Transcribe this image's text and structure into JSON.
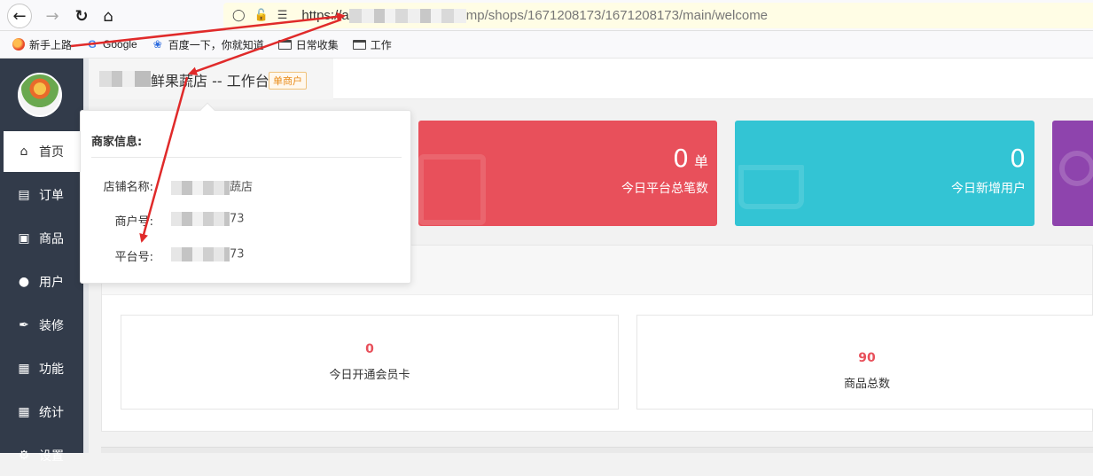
{
  "browser": {
    "url_prefix": "https://a",
    "url_suffix": "mp/shops/1671208173/1671208173/main/welcome",
    "bookmarks": [
      "新手上路",
      "Google",
      "百度一下，你就知道",
      "日常收集",
      "工作"
    ]
  },
  "header": {
    "store_title": "鲜果蔬店 -- 工作台",
    "badge": "单商户"
  },
  "sidebar": {
    "items": [
      {
        "label": "首页",
        "icon": "home-icon",
        "active": true
      },
      {
        "label": "订单",
        "icon": "order-icon"
      },
      {
        "label": "商品",
        "icon": "bag-icon"
      },
      {
        "label": "用户",
        "icon": "user-icon"
      },
      {
        "label": "装修",
        "icon": "brush-icon"
      },
      {
        "label": "功能",
        "icon": "grid-icon"
      },
      {
        "label": "统计",
        "icon": "grid-icon"
      },
      {
        "label": "设置",
        "icon": "gear-icon"
      }
    ]
  },
  "cards": [
    {
      "value": "0",
      "unit": "单",
      "label": "今日平台总笔数",
      "color": "#e8505b"
    },
    {
      "value": "0",
      "unit": "",
      "label": "今日新增用户",
      "color": "#33c4d4"
    },
    {
      "value": "",
      "unit": "",
      "label": "",
      "color": "#8e44ad"
    }
  ],
  "stats": [
    {
      "value": "0",
      "label": "今日开通会员卡"
    },
    {
      "value": "90",
      "label": "商品总数"
    }
  ],
  "popover": {
    "title": "商家信息:",
    "rows": [
      {
        "label": "店铺名称:",
        "value_suffix": "蔬店"
      },
      {
        "label": "商户号:",
        "value_suffix": "73"
      },
      {
        "label": "平台号:",
        "value_suffix": "73"
      }
    ]
  },
  "colors": {
    "sidebar_bg": "#323b4a",
    "card_red": "#e8505b",
    "card_cyan": "#33c4d4",
    "card_purple": "#8e44ad",
    "annotation": "#e02a2a"
  }
}
